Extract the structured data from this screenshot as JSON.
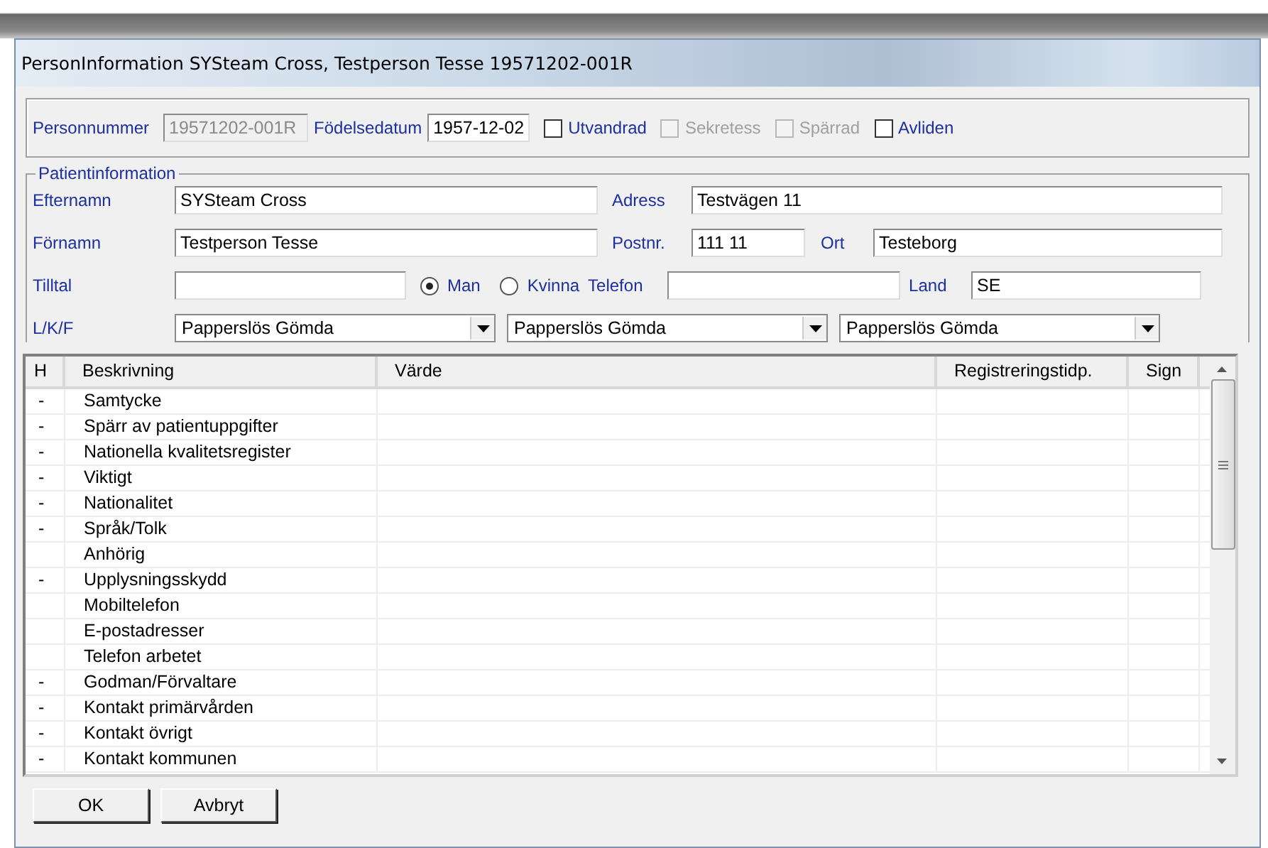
{
  "window": {
    "title": "PersonInformation SYSteam Cross, Testperson Tesse 19571202-001R"
  },
  "identity": {
    "personnummer": {
      "label": "Personnummer",
      "value": "19571202-001R",
      "disabled": true
    },
    "birth_date": {
      "label": "Födelsedatum",
      "value": "1957-12-02",
      "disabled": false
    },
    "flags": [
      {
        "label": "Utvandrad",
        "checked": false,
        "disabled": false
      },
      {
        "label": "Sekretess",
        "checked": false,
        "disabled": true
      },
      {
        "label": "Spärrad",
        "checked": false,
        "disabled": true
      },
      {
        "label": "Avliden",
        "checked": false,
        "disabled": false
      }
    ]
  },
  "patient": {
    "title": "Patientinformation",
    "surname": {
      "label": "Efternamn",
      "value": "SYSteam Cross"
    },
    "address": {
      "label": "Adress",
      "value": "Testvägen 11"
    },
    "first_name": {
      "label": "Förnamn",
      "value": "Testperson Tesse"
    },
    "postcode": {
      "label": "Postnr.",
      "value": "111 11"
    },
    "city": {
      "label": "Ort",
      "value": "Testeborg"
    },
    "nickname": {
      "label": "Tilltal"
    },
    "gender": [
      {
        "label": "Man",
        "selected": true
      },
      {
        "label": "Kvinna",
        "selected": false
      }
    ],
    "phone": {
      "label": "Telefon"
    },
    "country": {
      "label": "Land",
      "value": "SE"
    },
    "lkf": {
      "label": "L/K/F",
      "values": [
        "Papperslös Gömda",
        "Papperslös Gömda",
        "Papperslös Gömda"
      ]
    }
  },
  "table": {
    "columns": [
      "H",
      "Beskrivning",
      "Värde",
      "Registreringstidp.",
      "Sign"
    ],
    "rows": [
      {
        "h": "-",
        "description": "Samtycke"
      },
      {
        "h": "-",
        "description": "Spärr av patientuppgifter"
      },
      {
        "h": "-",
        "description": "Nationella kvalitetsregister"
      },
      {
        "h": "-",
        "description": "Viktigt"
      },
      {
        "h": "-",
        "description": "Nationalitet"
      },
      {
        "h": "-",
        "description": "Språk/Tolk"
      },
      {
        "description": "Anhörig"
      },
      {
        "h": "-",
        "description": "Upplysningsskydd"
      },
      {
        "description": "Mobiltelefon"
      },
      {
        "description": "E-postadresser"
      },
      {
        "description": "Telefon arbetet"
      },
      {
        "h": "-",
        "description": "Godman/Förvaltare"
      },
      {
        "h": "-",
        "description": "Kontakt primärvården"
      },
      {
        "h": "-",
        "description": "Kontakt övrigt"
      },
      {
        "h": "-",
        "description": "Kontakt kommunen"
      }
    ]
  },
  "buttons": [
    "OK",
    "Avbryt"
  ]
}
